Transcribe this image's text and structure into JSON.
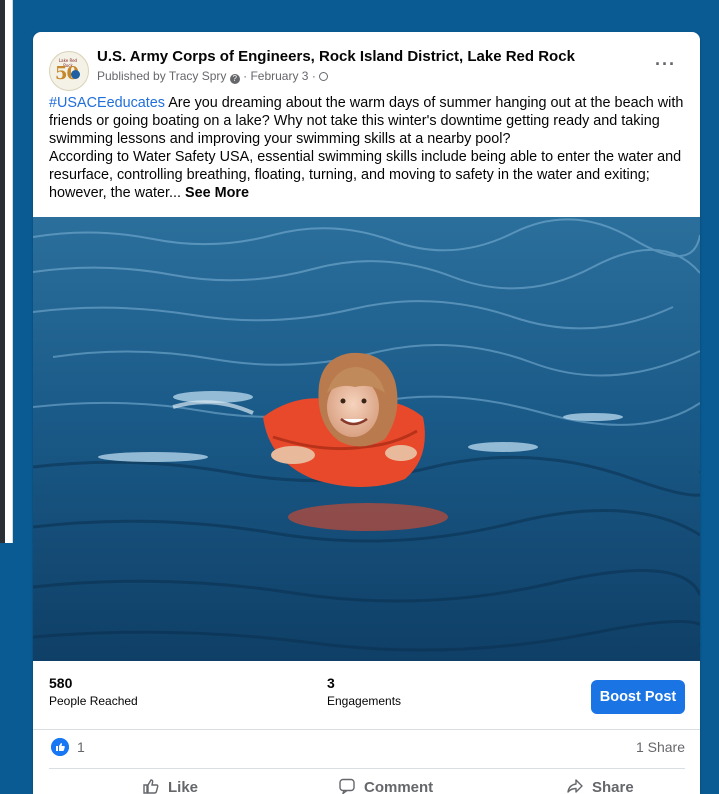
{
  "post": {
    "page_name": "U.S. Army Corps of Engineers, Rock Island District, Lake Red Rock",
    "published_by": "Published by Tracy Spry",
    "date": "February 3",
    "hashtag": "#USACEeducates",
    "body": " Are you dreaming about the warm days of summer hanging out at the beach with friends or going boating on a lake?  Why not take this winter's downtime getting ready and taking swimming lessons and improving your swimming skills at a nearby pool?",
    "body2": "According to Water Safety USA, essential swimming skills include being able to enter the water and resurface, controlling breathing, floating, turning, and moving to safety in the water and exiting;  however, the water... ",
    "see_more": "See More",
    "avatar_text": "Lake Red Rock",
    "avatar_number": "50"
  },
  "stats": {
    "reached_value": "580",
    "reached_label": "People Reached",
    "engagements_value": "3",
    "engagements_label": "Engagements",
    "boost_label": "Boost Post"
  },
  "reactions": {
    "count": "1",
    "shares": "1 Share"
  },
  "actions": {
    "like": "Like",
    "comment": "Comment",
    "share": "Share"
  },
  "colors": {
    "page_background": "#0a5a93",
    "accent": "#1b74e4",
    "hashtag": "#216fdb"
  }
}
